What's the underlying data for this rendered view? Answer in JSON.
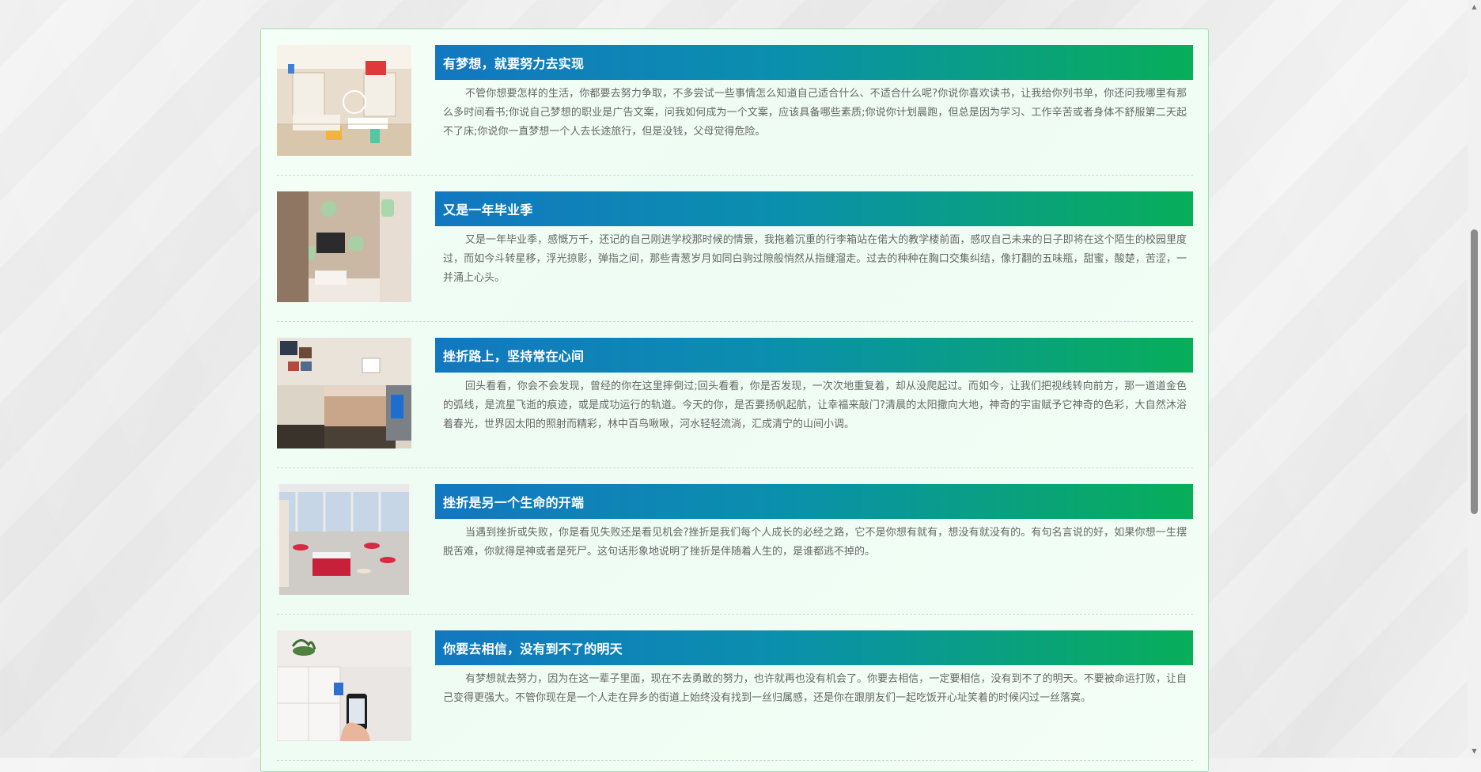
{
  "articles": [
    {
      "title": "有梦想，就要努力去实现",
      "excerpt": "不管你想要怎样的生活，你都要去努力争取，不多尝试一些事情怎么知道自己适合什么、不适合什么呢?你说你喜欢读书，让我给你列书单，你还问我哪里有那么多时间看书;你说自己梦想的职业是广告文案，问我如何成为一个文案，应该具备哪些素质;你说你计划晨跑，但总是因为学习、工作辛苦或者身体不舒服第二天起不了床;你说你一直梦想一个人去长途旅行，但是没钱，父母觉得危险。",
      "image": "smart-living-room-photo"
    },
    {
      "title": "又是一年毕业季",
      "excerpt": "又是一年毕业季，感慨万千，还记的自己刚进学校那时候的情景，我拖着沉重的行李箱站在偌大的教学楼前面，感叹自己未来的日子即将在这个陌生的校园里度过，而如今斗转星移，浮光掠影，弹指之间，那些青葱岁月如同白驹过隙般悄然从指缝溜走。过去的种种在胸口交集纠结，像打翻的五味瓶，甜蜜，酸楚，苦涩，一并涌上心头。",
      "image": "smart-tv-wall-photo"
    },
    {
      "title": "挫折路上，坚持常在心间",
      "excerpt": "回头看看，你会不会发现，曾经的你在这里摔倒过;回头看看，你是否发现，一次次地重复着，却从没爬起过。而如今，让我们把视线转向前方，那一道道金色的弧线，是流星飞逝的痕迹，或是成功运行的轨道。今天的你，是否要扬帆起航，让幸福来敲门?清晨的太阳撒向大地，神奇的宇宙赋予它神奇的色彩，大自然沐浴着春光，世界因太阳的照射而精彩，林中百鸟啾啾，河水轻轻流淌，汇成清宁的山间小调。",
      "image": "smart-bedroom-photo"
    },
    {
      "title": "挫折是另一个生命的开端",
      "excerpt": "当遇到挫折或失败，你是看见失败还是看见机会?挫折是我们每个人成长的必经之路，它不是你想有就有，想没有就没有的。有句名言说的好，如果你想一生摆脱苦难，你就得是神或者是死尸。这句话形象地说明了挫折是伴随着人生的，是谁都逃不掉的。",
      "image": "lounge-interior-photo"
    },
    {
      "title": "你要去相信，没有到不了的明天",
      "excerpt": "有梦想就去努力，因为在这一辈子里面，现在不去勇敢的努力，也许就再也没有机会了。你要去相信，一定要相信，没有到不了的明天。不要被命运打败，让自己变得更强大。不管你现在是一个人走在异乡的街道上始终没有找到一丝归属感，还是你在跟朋友们一起吃饭开心址笑着的时候闪过一丝落寞。",
      "image": "smart-lock-phone-photo"
    }
  ],
  "colors": {
    "title_gradient_start": "#1277c1",
    "title_gradient_end": "#08ae59",
    "container_border": "#9ee0b2",
    "excerpt_text": "#666666"
  },
  "scrollbar": {
    "up_icon": "triangle-up-icon",
    "down_icon": "triangle-down-icon"
  }
}
